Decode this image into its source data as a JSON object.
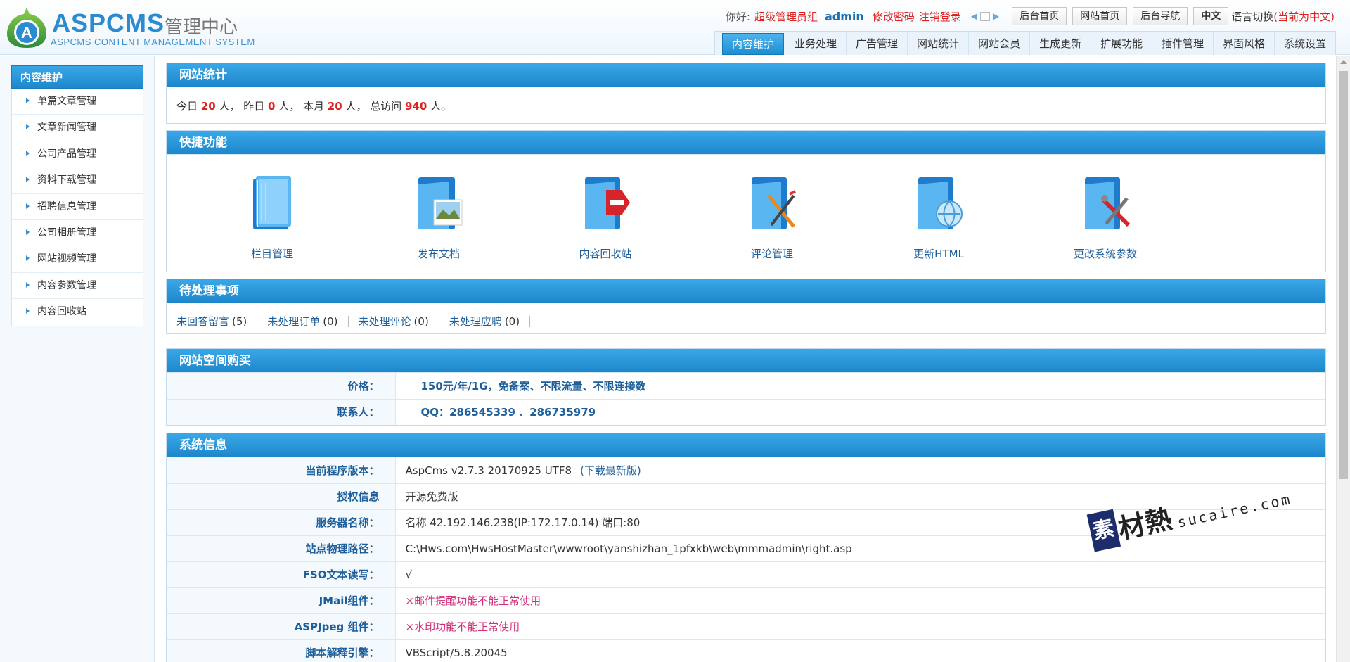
{
  "header": {
    "logo_text": "ASPCMS",
    "logo_cn": "管理中心",
    "logo_sub": "ASPCMS CONTENT MANAGEMENT SYSTEM",
    "greeting": "你好:",
    "role": "超级管理员组",
    "username": "admin",
    "change_password": "修改密码",
    "logout": "注销登录",
    "buttons": [
      "后台首页",
      "网站首页",
      "后台导航"
    ],
    "lang_button": "中文",
    "lang_switch": "语言切换",
    "lang_current": "(当前为中文)"
  },
  "nav_tabs": [
    "内容维护",
    "业务处理",
    "广告管理",
    "网站统计",
    "网站会员",
    "生成更新",
    "扩展功能",
    "插件管理",
    "界面风格",
    "系统设置"
  ],
  "sidebar": {
    "title": "内容维护",
    "items": [
      "单篇文章管理",
      "文章新闻管理",
      "公司产品管理",
      "资料下载管理",
      "招聘信息管理",
      "公司相册管理",
      "网站视频管理",
      "内容参数管理",
      "内容回收站"
    ]
  },
  "stats": {
    "title": "网站统计",
    "today_label": "今日",
    "today": "20",
    "yesterday_label": "人， 昨日",
    "yesterday": "0",
    "month_label": "人， 本月",
    "month": "20",
    "total_label": "人， 总访问",
    "total": "940",
    "suffix": "人。"
  },
  "quick": {
    "title": "快捷功能",
    "items": [
      {
        "label": "栏目管理",
        "icon": "folder-book-icon"
      },
      {
        "label": "发布文档",
        "icon": "folder-image-icon"
      },
      {
        "label": "内容回收站",
        "icon": "folder-delete-icon"
      },
      {
        "label": "评论管理",
        "icon": "folder-pencil-icon"
      },
      {
        "label": "更新HTML",
        "icon": "folder-globe-icon"
      },
      {
        "label": "更改系统参数",
        "icon": "folder-tools-icon"
      }
    ]
  },
  "pending": {
    "title": "待处理事项",
    "items": [
      {
        "label": "未回答留言",
        "count": "(5)"
      },
      {
        "label": "未处理订单",
        "count": "(0)"
      },
      {
        "label": "未处理评论",
        "count": "(0)"
      },
      {
        "label": "未处理应聘",
        "count": "(0)"
      }
    ]
  },
  "hosting": {
    "title": "网站空间购买",
    "price_label": "价格：",
    "price": "150元/年/1G，免备案、不限流量、不限连接数",
    "contact_label": "联系人：",
    "contact": "QQ：286545339 、286735979"
  },
  "sysinfo": {
    "title": "系统信息",
    "rows": [
      {
        "k": "当前程序版本：",
        "v": "AspCms v2.7.3 20170925 UTF8",
        "link": "(下载最新版)"
      },
      {
        "k": "授权信息",
        "v": "开源免费版"
      },
      {
        "k": "服务器名称：",
        "v": "名称 42.192.146.238(IP:172.17.0.14) 端口:80"
      },
      {
        "k": "站点物理路径：",
        "v": "C:\\Hws.com\\HwsHostMaster\\wwwroot\\yanshizhan_1pfxkb\\web\\mmmadmin\\right.asp"
      },
      {
        "k": "FSO文本读写：",
        "v": "√"
      },
      {
        "k": "JMail组件：",
        "v": "×邮件提醒功能不能正常使用"
      },
      {
        "k": "ASPJpeg 组件：",
        "v": "×水印功能不能正常使用"
      },
      {
        "k": "脚本解释引擎：",
        "v": "VBScript/5.8.20045"
      }
    ]
  },
  "watermark": {
    "box": "素",
    "cn": "材熱",
    "en": "sucaire.com"
  },
  "colors": {
    "accent": "#1d87cb",
    "highlight": "#dd2222",
    "link": "#1d5f9a"
  }
}
